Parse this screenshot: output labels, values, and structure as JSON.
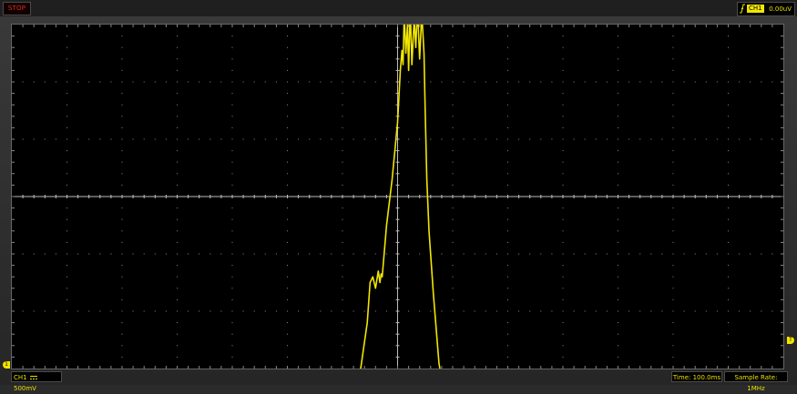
{
  "status": {
    "run_state": "STOP",
    "run_state_color": "#e22a1c"
  },
  "trigger": {
    "edge_icon": "rising-edge-icon",
    "channel": "CH1",
    "level": "0.00uV"
  },
  "markers": {
    "ch1_ground": "1",
    "trigger_level": "T"
  },
  "bottom": {
    "ch1_label": "CH1",
    "coupling_icon": "dc-coupling-icon",
    "ch1_scale": "500mV",
    "time_base": "Time: 100.0ms",
    "sample_rate": "Sample Rate: 1MHz"
  },
  "colors": {
    "trace": "#f2e600",
    "screen_bg": "#000000",
    "grid": "#8a8a8a"
  },
  "chart_data": {
    "type": "line",
    "grid": true,
    "grid_divisions": {
      "x": 14,
      "y": 6
    },
    "x_unit": "div",
    "y_unit": "div",
    "xlim": [
      0,
      14
    ],
    "ylim": [
      -3,
      3
    ],
    "series": [
      {
        "values": [
          [
            0.0,
            -3.2
          ],
          [
            6.2,
            -3.2
          ],
          [
            6.3,
            -3.2
          ],
          [
            6.45,
            -2.2
          ],
          [
            6.5,
            -1.5
          ],
          [
            6.55,
            -1.4
          ],
          [
            6.6,
            -1.6
          ],
          [
            6.65,
            -1.3
          ],
          [
            6.68,
            -1.5
          ],
          [
            6.7,
            -1.35
          ],
          [
            6.72,
            -1.4
          ],
          [
            6.8,
            -0.5
          ],
          [
            6.9,
            0.3
          ],
          [
            7.0,
            1.3
          ],
          [
            7.05,
            2.2
          ],
          [
            7.08,
            2.55
          ],
          [
            7.1,
            2.3
          ],
          [
            7.12,
            3.2
          ],
          [
            7.15,
            2.5
          ],
          [
            7.18,
            3.0
          ],
          [
            7.2,
            2.2
          ],
          [
            7.23,
            3.3
          ],
          [
            7.26,
            2.3
          ],
          [
            7.3,
            3.1
          ],
          [
            7.33,
            2.6
          ],
          [
            7.36,
            3.3
          ],
          [
            7.4,
            2.4
          ],
          [
            7.44,
            3.2
          ],
          [
            7.48,
            2.5
          ],
          [
            7.5,
            1.5
          ],
          [
            7.53,
            0.3
          ],
          [
            7.57,
            -0.6
          ],
          [
            7.65,
            -1.7
          ],
          [
            7.75,
            -2.9
          ],
          [
            7.8,
            -3.2
          ],
          [
            14.0,
            -3.2
          ]
        ]
      }
    ]
  }
}
